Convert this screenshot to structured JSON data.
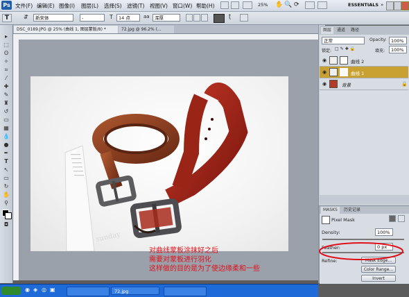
{
  "app": {
    "logo": "Ps"
  },
  "menu": [
    "文件(F)",
    "编辑(E)",
    "图像(I)",
    "图层(L)",
    "选择(S)",
    "滤镜(T)",
    "视图(V)",
    "窗口(W)",
    "帮助(H)"
  ],
  "menu_right": {
    "zoom": "25%",
    "workspace": "ESSENTIALS"
  },
  "options": {
    "tool_glyph": "T",
    "font_family": "新宋体",
    "font_style": "-",
    "font_size": "14 点",
    "antialias": "浑厚"
  },
  "doc_tabs": [
    "DSC_0189.JPG @ 25% (曲线 1, 图层蒙版/8) *",
    "72.jpg @ 96.2% (..."
  ],
  "photo_text": "sunday",
  "annotation": [
    "对曲线蒙板涂抹好之后",
    "需要对蒙板进行羽化",
    "这样做的目的是为了使边缘柔和一些"
  ],
  "status_bar": {
    "tab_label": "72.jpg"
  },
  "layers_panel": {
    "tabs": [
      "图层",
      "通道",
      "路径"
    ],
    "blend_mode": "正常",
    "opacity_label": "Opacity:",
    "opacity_value": "100%",
    "lock_label": "锁定:",
    "fill_label": "填充:",
    "fill_value": "100%",
    "layers": [
      {
        "name": "曲线 2",
        "selected": false
      },
      {
        "name": "曲线 1",
        "selected": true
      },
      {
        "name": "背景",
        "selected": false
      }
    ]
  },
  "masks_panel": {
    "tabs": [
      "MASKS",
      "历史记录"
    ],
    "title": "Pixel Mask",
    "density_label": "Density:",
    "density_value": "100%",
    "feather_label": "Feather:",
    "feather_value": "0 px",
    "refine_label": "Refine:",
    "buttons": [
      "Mask Edge...",
      "Color Range...",
      "Invert"
    ]
  },
  "colors": {
    "accent_layer": "#c9a133",
    "annotation": "#e0101a",
    "ellipse": "#e0101a"
  }
}
